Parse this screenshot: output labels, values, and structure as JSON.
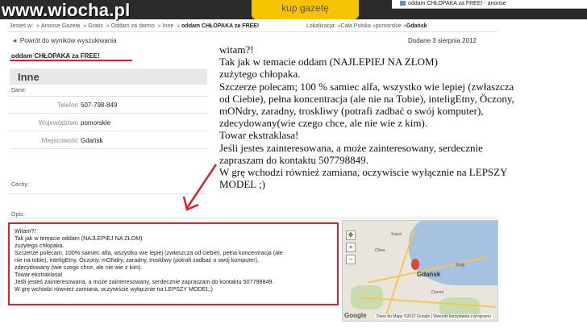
{
  "watermark": "www.wiocha.pl",
  "header": {
    "yellow_button": "kup gazetę",
    "tab_title": "oddam CHŁOPAKA za FREE! - anonse"
  },
  "breadcrumb": {
    "prefix": "Jesteś w:",
    "items": [
      "Anonse Gazeta",
      "Gratis",
      "Oddam za darmo",
      "Inne",
      "oddam CHŁOPAKA za FREE!"
    ]
  },
  "location": {
    "label": "Lokalizacja:",
    "items": [
      "Cała Polska",
      "pomorskie",
      "Gdańsk"
    ]
  },
  "back_link": "Powrót do wyników wyszukiwania",
  "date_added": "Dodane 3 sierpnia 2012",
  "ad_title": "oddam CHŁOPAKA za FREE!",
  "details": {
    "section_title": "Inne",
    "dane_label": "Dane:",
    "rows": [
      {
        "key": "Telefon",
        "value": "507-798-849"
      },
      {
        "key": "Województwo",
        "value": "pomorskie"
      },
      {
        "key": "Miejscowość",
        "value": "Gdańsk"
      }
    ],
    "cechy_label": "Cechy:",
    "opis_label": "Opis:"
  },
  "overlay_lines": [
    "witam?!",
    "Tak jak w temacie oddam (NAJLEPIEJ NA ZŁOM)",
    "zużytego chłopaka.",
    "Szczerze polecam; 100 % samiec alfa, wszystko wie lepiej  (zwłaszcza",
    "od Ciebie), pełna koncentracja (ale nie na Tobie), inteligEtny, Öczony,",
    "mONdry, zaradny, troskliwy (potrafi zadbać o swój komputer),",
    "zdecydowany(wie czego chce, ale nie wie z kim).",
    "Towar ekstraklasa!",
    "Jeśli jestes zainteresowana, a może zainteresowany, serdecznie",
    "zapraszam do kontaktu 507798849.",
    "W grę wchodzi również zamiana, oczywiscie wyłącznie na LEPSZY",
    "MODEL ;)"
  ],
  "description_lines": [
    "Witam?!",
    "Tak jak w temacie oddam (NAJLEPIEJ NA ZŁOM)",
    "zużytego chłopaka.",
    "Szczerze polecam; 100% samiec alfa, wszystko wie lepiej (zwłaszcza od ciebie), pełna koncentracja (ale",
    "nie na tobie), inteligEtny, Öczony, mONdry, zaradny, troskliwy (potrafi zadbać o swój komputer),",
    "zdecydowany (wie czego chce, ale nie wie z kim).",
    "Towar ekstraklasa!",
    "Jeśli jesteś zainteresowana, a może zainteresowany, serdecznie zapraszam do kontaktu 507798849.",
    "W grę wchodzi również zamiana, oczywiście wyłącznie na LEPSZY MODEL;)"
  ],
  "map": {
    "city": "Gdańsk",
    "zoom_in": "+",
    "zoom_out": "−",
    "attribution": "Dane do Mapy ©2012 Google | Warunki korzystania z programu",
    "logo": "Google",
    "place_labels": [
      "Sopot",
      "Oliwa",
      "Stogi",
      "Orunia"
    ]
  },
  "colors": {
    "accent_red": "#e0212b",
    "brand_yellow": "#f5c400"
  }
}
